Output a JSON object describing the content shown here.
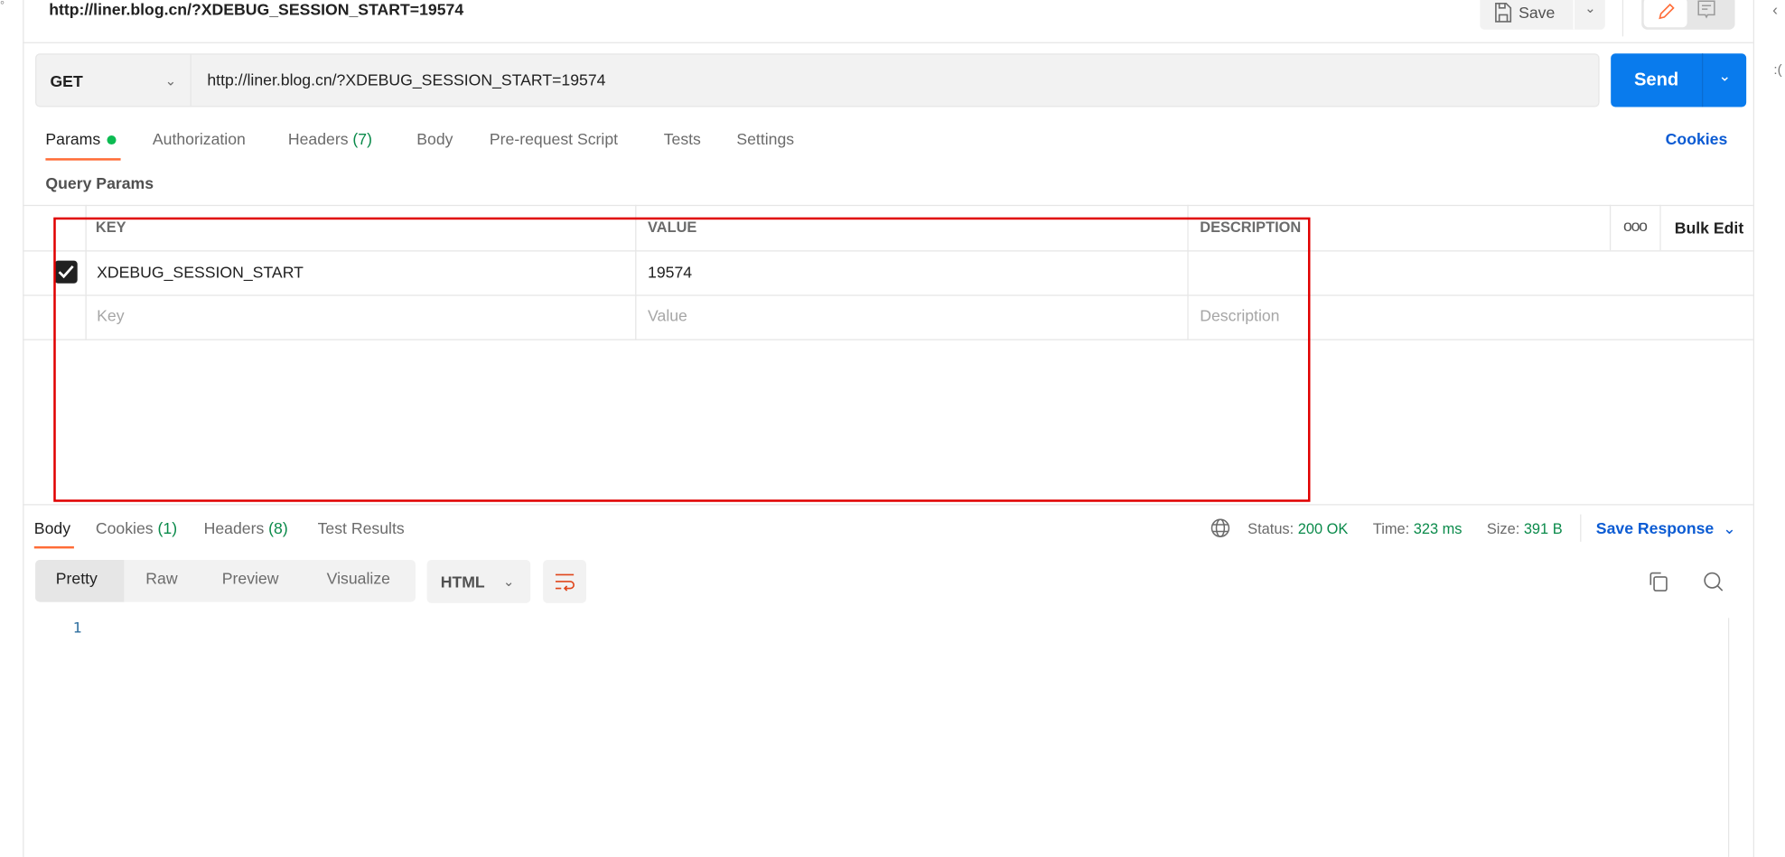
{
  "header": {
    "title": "http://liner.blog.cn/?XDEBUG_SESSION_START=19574",
    "save_label": "Save"
  },
  "request": {
    "method": "GET",
    "url": "http://liner.blog.cn/?XDEBUG_SESSION_START=19574",
    "send_label": "Send"
  },
  "request_tabs": [
    {
      "label": "Params",
      "active": true
    },
    {
      "label": "Authorization"
    },
    {
      "label": "Headers",
      "count": "(7)"
    },
    {
      "label": "Body"
    },
    {
      "label": "Pre-request Script"
    },
    {
      "label": "Tests"
    },
    {
      "label": "Settings"
    }
  ],
  "cookies_link": "Cookies",
  "query_params": {
    "title": "Query Params",
    "columns": [
      "KEY",
      "VALUE",
      "DESCRIPTION"
    ],
    "bulk_edit": "Bulk Edit",
    "rows": [
      {
        "checked": true,
        "key": "XDEBUG_SESSION_START",
        "value": "19574",
        "description": ""
      }
    ],
    "placeholders": {
      "key": "Key",
      "value": "Value",
      "description": "Description"
    }
  },
  "response_tabs": [
    {
      "label": "Body",
      "active": true
    },
    {
      "label": "Cookies",
      "count": "(1)"
    },
    {
      "label": "Headers",
      "count": "(8)"
    },
    {
      "label": "Test Results"
    }
  ],
  "response_meta": {
    "status_label": "Status:",
    "status": "200 OK",
    "time_label": "Time:",
    "time": "323 ms",
    "size_label": "Size:",
    "size": "391 B",
    "save_response": "Save Response"
  },
  "view_modes": [
    "Pretty",
    "Raw",
    "Preview",
    "Visualize"
  ],
  "active_view": "Pretty",
  "format": "HTML",
  "line_numbers": [
    "1"
  ],
  "colors": {
    "accent": "#ff6c37",
    "send": "#097bed",
    "link": "#0b5bd3",
    "success": "#0a8a4a",
    "highlight": "#e00000"
  }
}
